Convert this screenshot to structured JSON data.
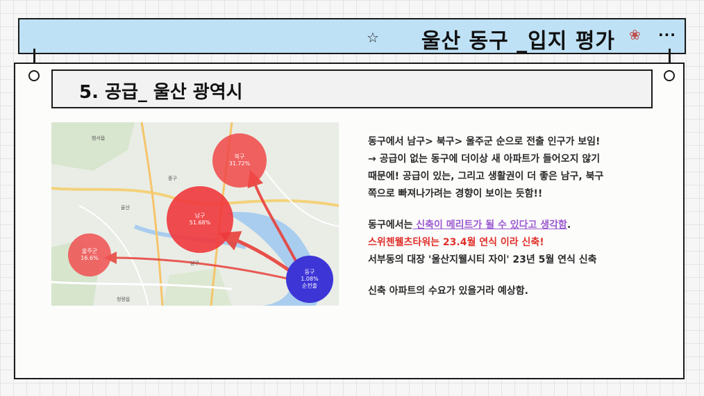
{
  "header": {
    "title": "울산 동구 _입지 평가",
    "star_icon": "☆",
    "snail_icon": "❀",
    "more_icon": "···"
  },
  "section": {
    "title": "5. 공급_ 울산 광역시"
  },
  "map": {
    "bubbles": [
      {
        "name": "북구",
        "percent": "31.72%"
      },
      {
        "name": "남구",
        "percent": "51.68%"
      },
      {
        "name": "울주군",
        "percent": "16.6%"
      },
      {
        "name": "동구",
        "percent": "1.08%",
        "extra": "순전출"
      }
    ],
    "labels": [
      "범서읍",
      "중구",
      "남구",
      "청량읍",
      "울산"
    ],
    "road_numbers": [
      "14",
      "7",
      "14",
      "24",
      "31"
    ]
  },
  "body": {
    "para1": [
      "동구에서 남구> 북구> 울주군 순으로 전출 인구가 보임!",
      "→ 공급이 없는 동구에 더이상 새 아파트가 들어오지 않기",
      "때문에! 공급이 있는, 그리고 생활권이 더 좋은 남구, 북구",
      "쪽으로 빠져나가려는 경향이 보이는 듯함!!"
    ],
    "para2_prefix": "동구에서는",
    "para2_highlight": " 신축이 메리트가 될 수 있다고 생각함",
    "para2_suffix": ".",
    "para3": "스위첸웰츠타워는  23.4월 연식 이라 신축!",
    "para4": "서부동의  대장 '울산지웰시티 자이' 23년 5월 연식 신축",
    "para5": "신축 아파트의 수요가 있을거라 예상함."
  }
}
